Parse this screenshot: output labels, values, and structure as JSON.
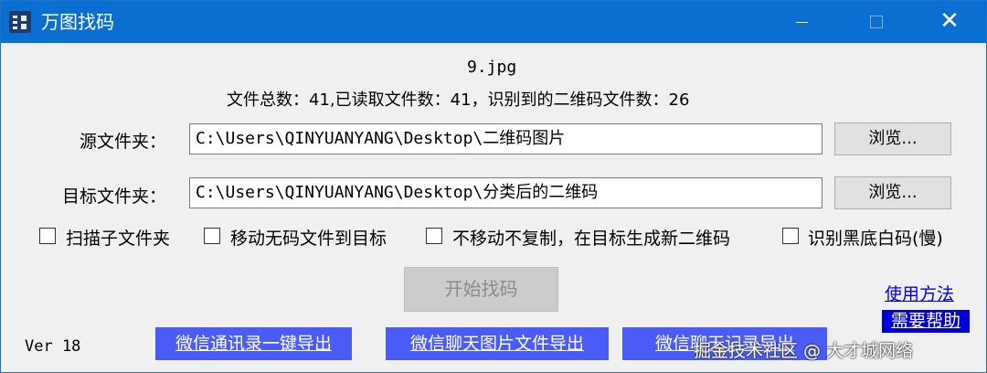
{
  "window": {
    "title": "万图找码",
    "close_glyph": "✕"
  },
  "status": {
    "filename": "9.jpg",
    "stats": "文件总数：41,已读取文件数：41，识别到的二维码文件数：26"
  },
  "source": {
    "label": "源文件夹：",
    "value": "C:\\Users\\QINYUANYANG\\Desktop\\二维码图片",
    "browse_label": "浏览..."
  },
  "target": {
    "label": "目标文件夹：",
    "value": "C:\\Users\\QINYUANYANG\\Desktop\\分类后的二维码",
    "browse_label": "浏览..."
  },
  "options": [
    {
      "label": "扫描子文件夹",
      "checked": false
    },
    {
      "label": "移动无码文件到目标",
      "checked": false
    },
    {
      "label": "不移动不复制，在目标生成新二维码",
      "checked": false
    },
    {
      "label": "识别黑底白码(慢)",
      "checked": false
    }
  ],
  "actions": {
    "start_label": "开始找码",
    "howto_label": "使用方法",
    "help_label": "需要帮助"
  },
  "footer": {
    "version": "Ver  18",
    "export_contacts": "微信通讯录一键导出",
    "export_chat_images": "微信聊天图片文件导出",
    "export_chat_records": "微信聊天记录导出",
    "watermark": "掘金技术社区 @ 大才城网络"
  },
  "colors": {
    "titlebar": "#0b6fd1",
    "export_button": "#4a5cf5",
    "help_button": "#0000d8",
    "link": "#0000ee"
  }
}
